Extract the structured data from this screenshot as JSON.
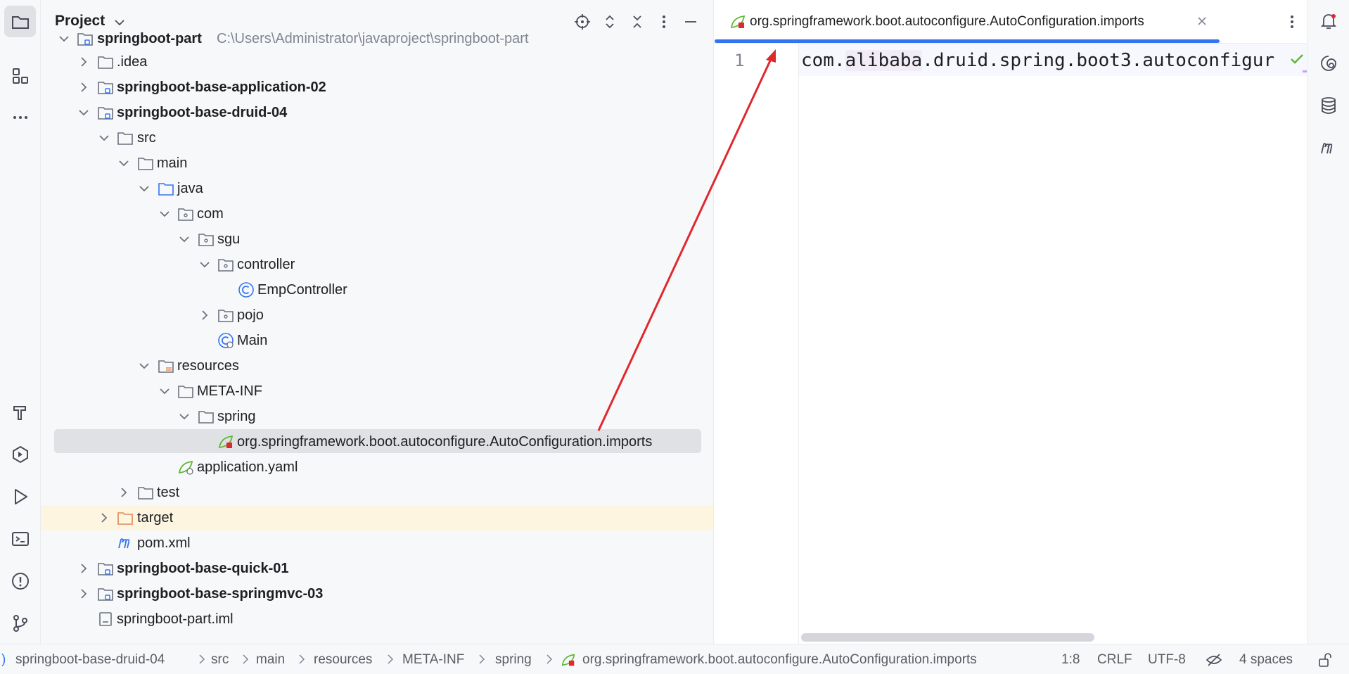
{
  "left_strip": {
    "items": [
      {
        "name": "project",
        "icon": "folder-icon",
        "active": true
      },
      {
        "name": "structure",
        "icon": "structure-icon",
        "active": false
      },
      {
        "name": "more",
        "icon": "more-horizontal-icon",
        "active": false
      },
      {
        "name": "build",
        "icon": "hammer-icon",
        "active": false
      },
      {
        "name": "services",
        "icon": "services-icon",
        "active": false
      },
      {
        "name": "run",
        "icon": "run-icon",
        "active": false
      },
      {
        "name": "terminal",
        "icon": "terminal-icon",
        "active": false
      },
      {
        "name": "problems",
        "icon": "problems-icon",
        "active": false
      },
      {
        "name": "git",
        "icon": "git-icon",
        "active": false
      }
    ]
  },
  "project_panel": {
    "title": "Project",
    "header_icons": [
      "locate-icon",
      "expand-all-icon",
      "collapse-all-icon",
      "options-icon",
      "hide-icon"
    ],
    "tree": {
      "root": {
        "label": "springboot-part",
        "path": "C:\\Users\\Administrator\\javaproject\\springboot-part"
      },
      "idea": ".idea",
      "module_app": "springboot-base-application-02",
      "module_druid": "springboot-base-druid-04",
      "src": "src",
      "main": "main",
      "java": "java",
      "com": "com",
      "sgu": "sgu",
      "controller": "controller",
      "emp_controller": "EmpController",
      "pojo": "pojo",
      "main_class": "Main",
      "resources": "resources",
      "meta_inf": "META-INF",
      "spring": "spring",
      "imports_file": "org.springframework.boot.autoconfigure.AutoConfiguration.imports",
      "application_yaml": "application.yaml",
      "test": "test",
      "target": "target",
      "pom": "pom.xml",
      "module_quick": "springboot-base-quick-01",
      "module_mvc": "springboot-base-springmvc-03",
      "iml": "springboot-part.iml"
    }
  },
  "editor": {
    "tab_label": "org.springframework.boot.autoconfigure.AutoConfiguration.imports",
    "line_number": "1",
    "code": {
      "part1": "com.",
      "part2": "alibaba",
      "part3": ".druid.spring.boot3.autoconfigur"
    }
  },
  "right_strip": {
    "items": [
      "notifications-icon",
      "ai-assistant-icon",
      "database-icon",
      "maven-icon"
    ]
  },
  "status_bar": {
    "breadcrumbs": [
      "springboot-base-druid-04",
      "src",
      "main",
      "resources",
      "META-INF",
      "spring",
      "org.springframework.boot.autoconfigure.AutoConfiguration.imports"
    ],
    "position": "1:8",
    "line_ending": "CRLF",
    "encoding": "UTF-8",
    "indent": "4 spaces"
  },
  "colors": {
    "accent": "#3574f0",
    "annotation_arrow": "#e0282d",
    "selection": "#dfe1e5",
    "excluded_folder_bg": "#fdf5e0",
    "spring_green": "#5fb832"
  }
}
